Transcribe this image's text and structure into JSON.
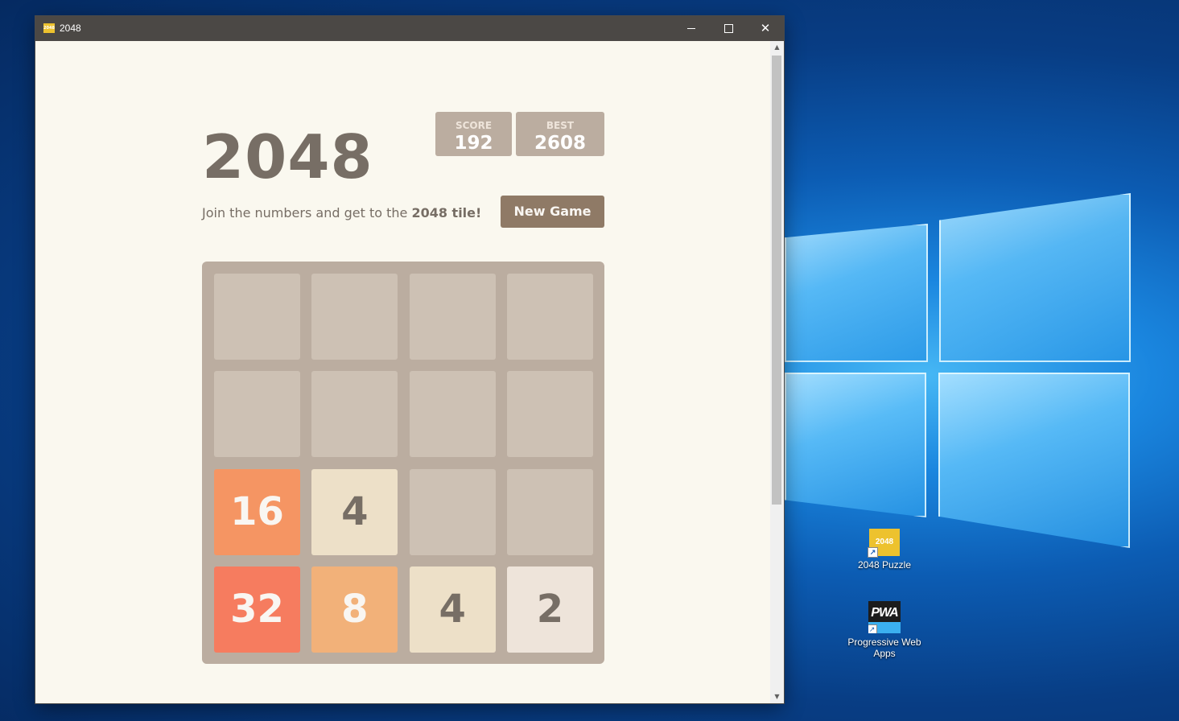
{
  "window": {
    "title": "2048",
    "app_icon_text": "2048",
    "minimize_icon": "minimize-icon",
    "maximize_icon": "maximize-icon",
    "close_label": "✕"
  },
  "game": {
    "title": "2048",
    "score_label": "SCORE",
    "score": "192",
    "best_label": "BEST",
    "best": "2608",
    "intro_prefix": "Join the numbers and get to the ",
    "intro_bold": "2048 tile!",
    "new_game_label": "New Game",
    "board": [
      [
        "",
        "",
        "",
        ""
      ],
      [
        "",
        "",
        "",
        ""
      ],
      [
        "16",
        "4",
        "",
        ""
      ],
      [
        "32",
        "8",
        "4",
        "2"
      ]
    ]
  },
  "desktop": {
    "icons": [
      {
        "label": "2048 Puzzle",
        "image_text": "2048"
      },
      {
        "label": "Progressive Web Apps",
        "image_text": "PWA"
      }
    ]
  },
  "colors": {
    "tile_empty": "#cdc1b4",
    "tile_2": "#eee4da",
    "tile_4": "#ede0c8",
    "tile_8": "#f2b179",
    "tile_16": "#f59563",
    "tile_32": "#f67c5f",
    "board": "#bbada0",
    "button": "#8f7a66"
  }
}
